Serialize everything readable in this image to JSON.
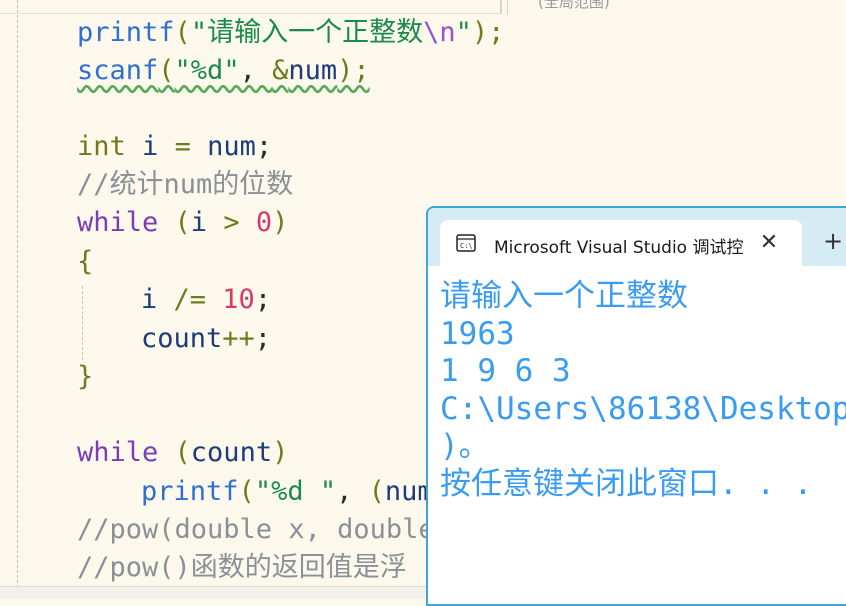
{
  "top_strip": {
    "scope_label": "(全局范围)"
  },
  "code_lines": [
    {
      "tokens": [
        {
          "t": "printf",
          "c": "fn"
        },
        {
          "t": "(",
          "c": "paren"
        },
        {
          "t": "\"请输入一个正整数",
          "c": "str"
        },
        {
          "t": "\\n",
          "c": "esc"
        },
        {
          "t": "\"",
          "c": "str"
        },
        {
          "t": ");",
          "c": "paren"
        }
      ]
    },
    {
      "tokens": [
        {
          "t": "scanf",
          "c": "fn"
        },
        {
          "t": "(",
          "c": "paren"
        },
        {
          "t": "\"%d\"",
          "c": "str"
        },
        {
          "t": ", ",
          "c": "pun"
        },
        {
          "t": "&",
          "c": "op"
        },
        {
          "t": "num",
          "c": "var"
        },
        {
          "t": ");",
          "c": "paren"
        }
      ]
    },
    {
      "tokens": [
        {
          "t": "int",
          "c": "type"
        },
        {
          "t": " i ",
          "c": "var"
        },
        {
          "t": "=",
          "c": "op"
        },
        {
          "t": " num",
          "c": "var"
        },
        {
          "t": ";",
          "c": "pun"
        }
      ]
    },
    {
      "tokens": [
        {
          "t": "//统计num的位数",
          "c": "cmt"
        }
      ]
    },
    {
      "tokens": [
        {
          "t": "while",
          "c": "kw"
        },
        {
          "t": " (",
          "c": "paren"
        },
        {
          "t": "i",
          "c": "var"
        },
        {
          "t": " > ",
          "c": "op"
        },
        {
          "t": "0",
          "c": "num"
        },
        {
          "t": ")",
          "c": "paren"
        }
      ]
    },
    {
      "tokens": [
        {
          "t": "{",
          "c": "paren"
        }
      ]
    },
    {
      "tokens": [
        {
          "t": "i",
          "c": "var"
        },
        {
          "t": " /= ",
          "c": "op"
        },
        {
          "t": "10",
          "c": "num"
        },
        {
          "t": ";",
          "c": "pun"
        }
      ]
    },
    {
      "tokens": [
        {
          "t": "count",
          "c": "var"
        },
        {
          "t": "++",
          "c": "op"
        },
        {
          "t": ";",
          "c": "pun"
        }
      ]
    },
    {
      "tokens": [
        {
          "t": "}",
          "c": "paren"
        }
      ]
    },
    {
      "tokens": [
        {
          "t": "while",
          "c": "kw"
        },
        {
          "t": " (",
          "c": "paren"
        },
        {
          "t": "count",
          "c": "var"
        },
        {
          "t": ")",
          "c": "paren"
        }
      ]
    },
    {
      "tokens": [
        {
          "t": "printf",
          "c": "fn"
        },
        {
          "t": "(",
          "c": "paren"
        },
        {
          "t": "\"%d \"",
          "c": "str"
        },
        {
          "t": ", ",
          "c": "pun"
        },
        {
          "t": "(",
          "c": "paren"
        },
        {
          "t": "num",
          "c": "var"
        }
      ]
    },
    {
      "tokens": [
        {
          "t": "//pow(double x, double",
          "c": "cmt"
        }
      ]
    },
    {
      "tokens": [
        {
          "t": "//pow()函数的返回值是浮",
          "c": "cmt"
        }
      ]
    }
  ],
  "console": {
    "tab_title": "Microsoft Visual Studio 调试控",
    "close_glyph": "✕",
    "new_tab_glyph": "+",
    "lines": [
      "请输入一个正整数",
      "1963",
      "1 9 6 3",
      "C:\\Users\\86138\\Desktop",
      ")。",
      "按任意键关闭此窗口. . ."
    ]
  }
}
